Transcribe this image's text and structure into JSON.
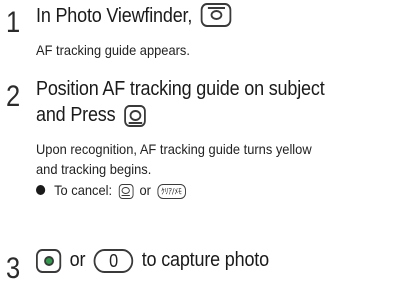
{
  "steps": [
    {
      "number": "1",
      "title": "In Photo Viewfinder,",
      "key_icon": "camera-key-icon",
      "description": "AF tracking guide appears."
    },
    {
      "number": "2",
      "title_line1": "Position AF tracking guide on subject",
      "title_line2": "and Press",
      "key_icon": "center-key-icon",
      "description_line1": "Upon recognition, AF tracking guide turns yellow",
      "description_line2": "and tracking begins.",
      "bullet_text": "To cancel:",
      "or_text": "or",
      "clear_key_label": "ｸﾘｱ/ﾒﾓ"
    },
    {
      "number": "3",
      "or_text": "or",
      "zero_key_label": "0",
      "title_tail": "to capture photo"
    }
  ],
  "colors": {
    "text": "#1a1a1a",
    "key_outline": "#3a3a3a",
    "shutter_green": "#2e9c4a"
  }
}
